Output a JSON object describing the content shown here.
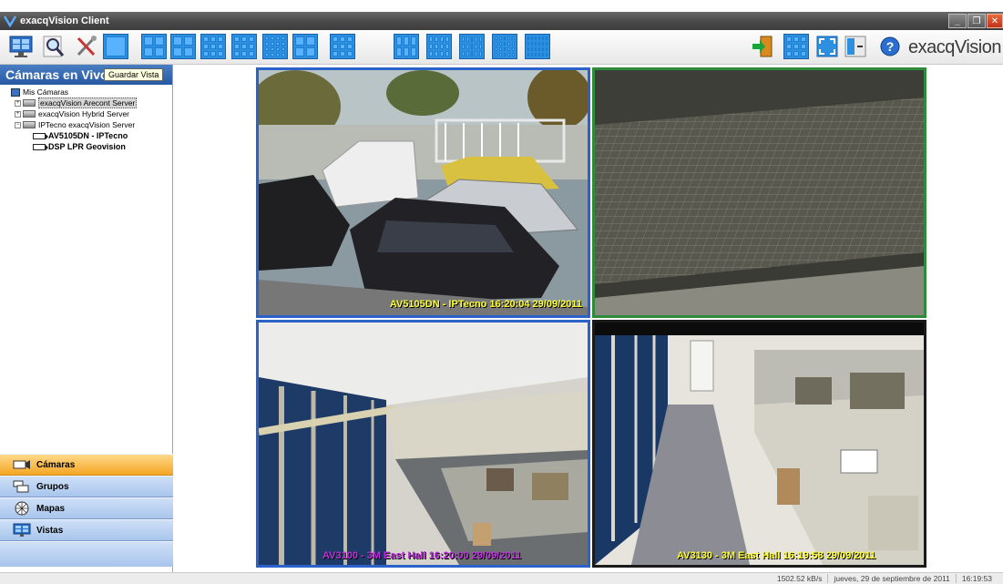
{
  "window": {
    "title": "exacqVision Client"
  },
  "toolbar": {
    "brand": "exacqVision",
    "tooltip": "Guardar Vista"
  },
  "sidebar": {
    "header": "Cámaras en Vivo",
    "tree": {
      "root": "Mis Cámaras",
      "servers": [
        {
          "label": "exacqVision Arecont Server"
        },
        {
          "label": "exacqVision Hybrid Server"
        },
        {
          "label": "IPTecno exacqVision Server"
        }
      ],
      "cameras": [
        {
          "label": "AV5105DN - IPTecno"
        },
        {
          "label": "DSP LPR Geovision"
        }
      ]
    },
    "nav": [
      {
        "label": "Cámaras",
        "icon": "camera-icon",
        "active": true
      },
      {
        "label": "Grupos",
        "icon": "group-icon",
        "active": false
      },
      {
        "label": "Mapas",
        "icon": "map-icon",
        "active": false
      },
      {
        "label": "Vistas",
        "icon": "views-icon",
        "active": false
      }
    ]
  },
  "cameras": [
    {
      "overlay": "AV5105DN - IPTecno 16:20:04 29/09/2011",
      "overlay_color": "#ffff33",
      "border": "#2a62c9"
    },
    {
      "overlay": "",
      "overlay_color": "#ffff33",
      "border": "#2e8b3a"
    },
    {
      "overlay": "AV3100 - 3M East Hall 16:20:00 29/09/2011",
      "overlay_color": "#c030e0",
      "border": "#2a62c9"
    },
    {
      "overlay": "AV3130 - 3M East Hall 16:19:58 29/09/2011",
      "overlay_color": "#ffff33",
      "border": "#1a1a1a"
    }
  ],
  "status": {
    "bandwidth": "1502.52 kB/s",
    "date": "jueves, 29 de septiembre de 2011",
    "time": "16:19:53"
  },
  "colors": {
    "accent": "#2d8fe0",
    "nav_active": "#f5a623",
    "sidebar_header": "#2659a3"
  }
}
